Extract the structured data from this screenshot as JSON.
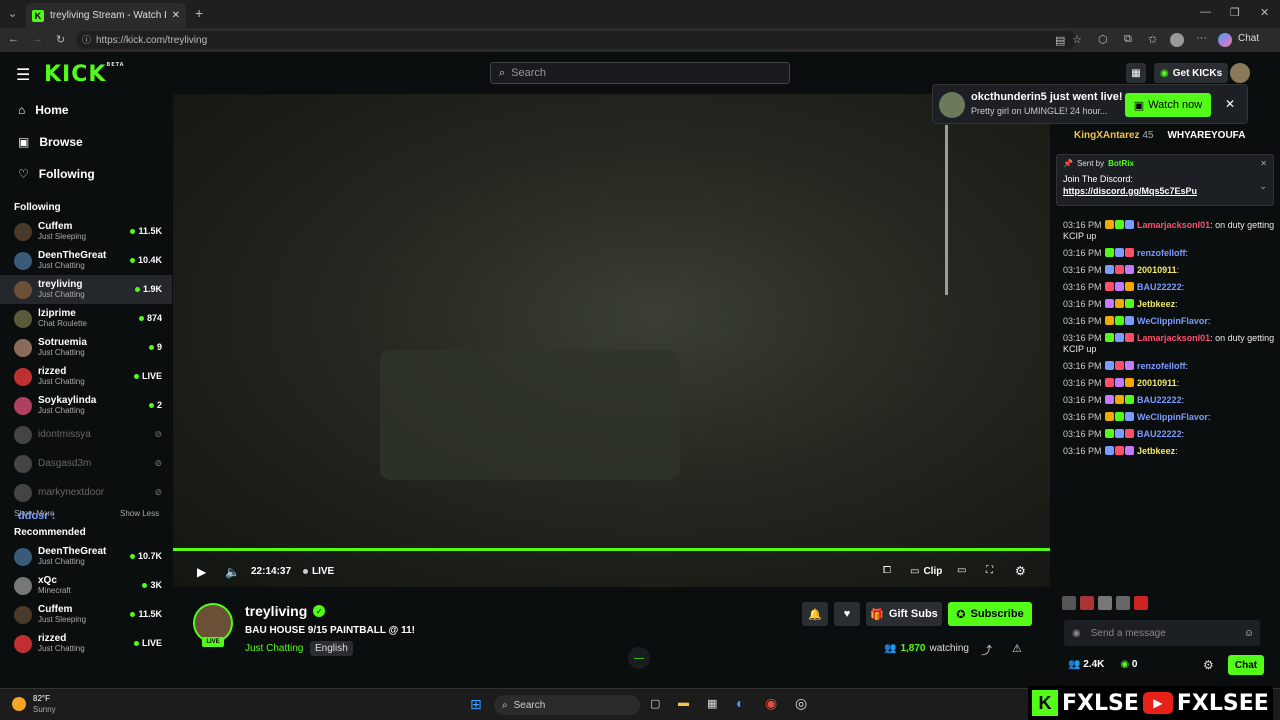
{
  "browser": {
    "tab_title": "treyliving Stream - Watch Live on",
    "url": "https://kick.com/treyliving",
    "chat_btn": "Chat"
  },
  "site": {
    "logo": "KICK",
    "logo_badge": "BETA",
    "search_placeholder": "Search",
    "get_kicks": "Get KICKs"
  },
  "nav": {
    "home": "Home",
    "browse": "Browse",
    "following": "Following"
  },
  "following_title": "Following",
  "following": [
    {
      "name": "Cuffem",
      "cat": "Just Sleeping",
      "viewers": "11.5K",
      "color": "#4a3a2a"
    },
    {
      "name": "DeenTheGreat",
      "cat": "Just Chatting",
      "viewers": "10.4K",
      "color": "#3a5a7a"
    },
    {
      "name": "treyliving",
      "cat": "Just Chatting",
      "viewers": "1.9K",
      "color": "#6b4f36"
    },
    {
      "name": "lziprime",
      "cat": "Chat Roulette",
      "viewers": "874",
      "color": "#5a5a3a"
    },
    {
      "name": "Sotruemia",
      "cat": "Just Chatting",
      "viewers": "9",
      "color": "#8a6a5a"
    },
    {
      "name": "rizzed",
      "cat": "Just Chatting",
      "viewers": "LIVE",
      "color": "#c03030"
    },
    {
      "name": "Soykaylinda",
      "cat": "Just Chatting",
      "viewers": "2",
      "color": "#b04060"
    }
  ],
  "offline": [
    "idontmissya",
    "Dasgasd3m",
    "markynextdoor"
  ],
  "show_more": "Show More",
  "show_less": "Show Less",
  "ddosr": "ddosr :",
  "recommended_title": "Recommended",
  "recommended": [
    {
      "name": "DeenTheGreat",
      "cat": "Just Chatting",
      "viewers": "10.7K",
      "color": "#3a5a7a"
    },
    {
      "name": "xQc",
      "cat": "Minecraft",
      "viewers": "3K",
      "color": "#777"
    },
    {
      "name": "Cuffem",
      "cat": "Just Sleeping",
      "viewers": "11.5K",
      "color": "#4a3a2a"
    },
    {
      "name": "rizzed",
      "cat": "Just Chatting",
      "viewers": "LIVE",
      "color": "#c03030"
    }
  ],
  "player": {
    "time": "22:14:37",
    "live": "LIVE",
    "clip": "Clip",
    "progress": 1.0
  },
  "stream": {
    "name": "treyliving",
    "title": "BAU HOUSE 9/15 PAINTBALL @ 11!",
    "category": "Just Chatting",
    "language": "English",
    "watching_count": "1,870",
    "watching_label": "watching",
    "live_badge": "LIVE",
    "gift_subs": "Gift Subs",
    "subscribe": "Subscribe"
  },
  "notification": {
    "title": "okcthunderin5 just went live!",
    "sub": "Pretty girl on UMINGLE! 24 hour...",
    "btn": "Watch now"
  },
  "chat": {
    "top": [
      {
        "name": "KingXAntarez",
        "count": "45"
      },
      {
        "name": "WHYAREYOUFA"
      }
    ],
    "pinned_sent_by": "Sent by",
    "pinned_user": "BotRix",
    "pinned_text": "Join The Discord:",
    "pinned_link": "https://discord.gg/Mqs5c7EsPu",
    "messages": [
      {
        "time": "03:16 PM",
        "user": "Lamarjacksonl01",
        "color": "#ff4d6d",
        "text": "on duty getting KCIP up"
      },
      {
        "time": "03:16 PM",
        "user": "renzofelloff",
        "color": "#7a9cff",
        "text": ""
      },
      {
        "time": "03:16 PM",
        "user": "20010911",
        "color": "#f2e86a",
        "text": ""
      },
      {
        "time": "03:16 PM",
        "user": "BAU22222",
        "color": "#7a9cff",
        "text": ""
      },
      {
        "time": "03:16 PM",
        "user": "Jetbkeez",
        "color": "#f2e86a",
        "text": ""
      },
      {
        "time": "03:16 PM",
        "user": "WeClippinFlavor",
        "color": "#7a9cff",
        "text": ""
      },
      {
        "time": "03:16 PM",
        "user": "Lamarjacksonl01",
        "color": "#ff4d6d",
        "text": "on duty getting KCIP up"
      },
      {
        "time": "03:16 PM",
        "user": "renzofelloff",
        "color": "#7a9cff",
        "text": ""
      },
      {
        "time": "03:16 PM",
        "user": "20010911",
        "color": "#f2e86a",
        "text": ""
      },
      {
        "time": "03:16 PM",
        "user": "BAU22222",
        "color": "#7a9cff",
        "text": ""
      },
      {
        "time": "03:16 PM",
        "user": "WeClippinFlavor",
        "color": "#7a9cff",
        "text": ""
      },
      {
        "time": "03:16 PM",
        "user": "BAU22222",
        "color": "#7a9cff",
        "text": ""
      },
      {
        "time": "03:16 PM",
        "user": "Jetbkeez",
        "color": "#f2e86a",
        "text": ""
      }
    ],
    "placeholder": "Send a message",
    "followers": "2.4K",
    "kicks": "0",
    "chat_btn": "Chat"
  },
  "taskbar": {
    "temp": "82°F",
    "weather": "Sunny",
    "search": "Search"
  },
  "watermark": "FXLSE",
  "watermark2": "FXLSEE",
  "colors": {
    "accent": "#53fc18",
    "bg": "#0b0e0f"
  }
}
